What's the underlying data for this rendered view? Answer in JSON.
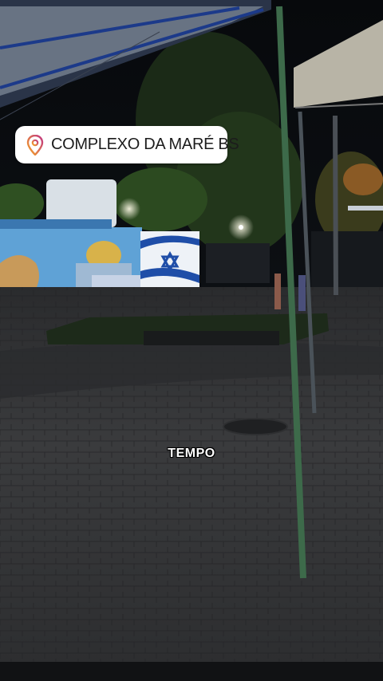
{
  "location_sticker": {
    "label": "COMPLEXO DA MARÉ BS",
    "icon": "location-pin-icon"
  },
  "caption": {
    "text": "TEMPO"
  },
  "colors": {
    "sticker_bg": "#ffffff",
    "pin_gradient_start": "#f5a623",
    "pin_gradient_end": "#c13584"
  }
}
